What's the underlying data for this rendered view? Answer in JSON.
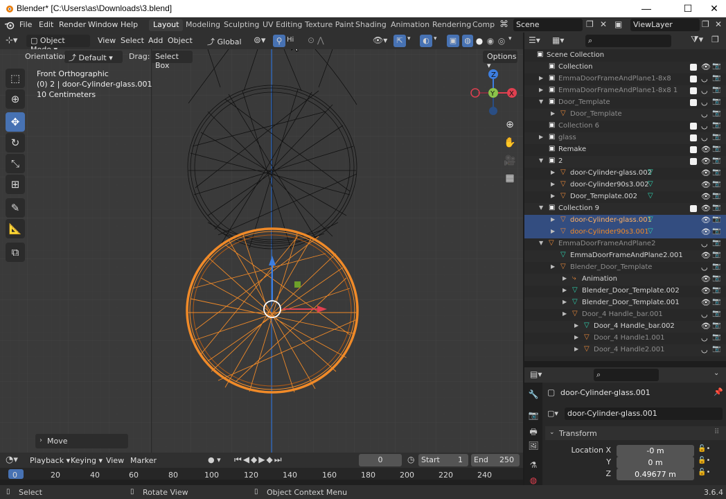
{
  "window": {
    "title": "Blender* [C:\\Users\\as\\Downloads\\3.blend]",
    "minimize": "—",
    "maximize": "☐",
    "close": "✕"
  },
  "menu": {
    "items": [
      "File",
      "Edit",
      "Render",
      "Window",
      "Help"
    ]
  },
  "workspaces": [
    "Layout",
    "Modeling",
    "Sculpting",
    "UV Editing",
    "Texture Paint",
    "Shading",
    "Animation",
    "Rendering",
    "Comp"
  ],
  "scene": {
    "label": "Scene",
    "view_layer": "ViewLayer"
  },
  "viewport_header": {
    "mode": "Object Mode",
    "view": "View",
    "select": "Select",
    "add": "Add",
    "object": "Object",
    "orientation": "Global",
    "snap_label": "Hi"
  },
  "viewport_sub": {
    "orientation_label": "Orientation:",
    "orientation_value": "Default",
    "drag_label": "Drag:",
    "drag_value": "Select Box",
    "options": "Options"
  },
  "overlay_text": {
    "view_name": "Front Orthographic",
    "object_info": "(0) 2 | door-Cylinder-glass.001",
    "scale": "10 Centimeters"
  },
  "gizmo": {
    "z": "Z",
    "y": "Y",
    "x": "X"
  },
  "operator_panel": "Move",
  "timeline": {
    "playback": "Playback",
    "keying": "Keying",
    "view": "View",
    "marker": "Marker",
    "current_frame": "0",
    "start_label": "Start",
    "start": "1",
    "end_label": "End",
    "end": "250",
    "ticks": [
      "0",
      "20",
      "40",
      "60",
      "80",
      "100",
      "120",
      "140",
      "160",
      "180",
      "200",
      "220",
      "240"
    ]
  },
  "statusbar": {
    "select": "Select",
    "rotate": "Rotate View",
    "context": "Object Context Menu",
    "version": "3.6.4"
  },
  "outliner": {
    "rows": [
      {
        "label": "Scene Collection",
        "indent": 0,
        "icon": "collection",
        "state": "normal"
      },
      {
        "label": "Collection",
        "indent": 1,
        "icon": "collection",
        "state": "normal",
        "check": true
      },
      {
        "label": "EmmaDoorFrameAndPlane1-8x8",
        "indent": 1,
        "icon": "collection",
        "state": "dim",
        "check": true,
        "arrow": true
      },
      {
        "label": "EmmaDoorFrameAndPlane1-8x8 1",
        "indent": 1,
        "icon": "collection",
        "state": "dim",
        "check": true,
        "arrow": true
      },
      {
        "label": "Door_Template",
        "indent": 1,
        "icon": "collection",
        "state": "dim",
        "check": true,
        "arrow": true
      },
      {
        "label": "Door_Template",
        "indent": 2,
        "icon": "object",
        "state": "dim",
        "arrow": true
      },
      {
        "label": "Collection 6",
        "indent": 1,
        "icon": "collection",
        "state": "dim",
        "check": true
      },
      {
        "label": "glass",
        "indent": 1,
        "icon": "collection",
        "state": "dim",
        "check": true,
        "arrow": true
      },
      {
        "label": "Remake",
        "indent": 1,
        "icon": "collection",
        "state": "normal",
        "check": true
      },
      {
        "label": "2",
        "indent": 1,
        "icon": "collection",
        "state": "normal",
        "check": true,
        "arrow": true
      },
      {
        "label": "door-Cylinder-glass.002",
        "indent": 2,
        "icon": "object",
        "state": "normal",
        "arrow": true
      },
      {
        "label": "door-Cylinder90s3.002",
        "indent": 2,
        "icon": "object",
        "state": "normal",
        "arrow": true
      },
      {
        "label": "Door_Template.002",
        "indent": 2,
        "icon": "object",
        "state": "normal",
        "arrow": true
      },
      {
        "label": "Collection 9",
        "indent": 1,
        "icon": "collection",
        "state": "normal",
        "check": true,
        "arrow": true
      },
      {
        "label": "door-Cylinder-glass.001",
        "indent": 2,
        "icon": "object",
        "state": "active",
        "arrow": true
      },
      {
        "label": "door-Cylinder90s3.001",
        "indent": 2,
        "icon": "object",
        "state": "selected",
        "arrow": true
      },
      {
        "label": "EmmaDoorFrameAndPlane2",
        "indent": 1,
        "icon": "object",
        "state": "dim",
        "arrow": true
      },
      {
        "label": "EmmaDoorFrameAndPlane2.001",
        "indent": 2,
        "icon": "mesh",
        "state": "normal"
      },
      {
        "label": "Blender_Door_Template",
        "indent": 2,
        "icon": "object",
        "state": "dim",
        "arrow": true
      },
      {
        "label": "Animation",
        "indent": 3,
        "icon": "anim",
        "state": "normal",
        "arrow": true
      },
      {
        "label": "Blender_Door_Template.002",
        "indent": 3,
        "icon": "mesh",
        "state": "normal",
        "arrow": true
      },
      {
        "label": "Blender_Door_Template.001",
        "indent": 3,
        "icon": "mesh",
        "state": "normal",
        "arrow": true
      },
      {
        "label": "Door_4 Handle_bar.001",
        "indent": 3,
        "icon": "object",
        "state": "dim",
        "arrow": true
      },
      {
        "label": "Door_4 Handle_bar.002",
        "indent": 4,
        "icon": "mesh",
        "state": "normal",
        "arrow": true
      },
      {
        "label": "Door_4 Handle1.001",
        "indent": 4,
        "icon": "object",
        "state": "dim",
        "arrow": true
      },
      {
        "label": "Door_4 Handle2.001",
        "indent": 4,
        "icon": "object",
        "state": "dim",
        "arrow": true
      }
    ]
  },
  "properties": {
    "object_name": "door-Cylinder-glass.001",
    "object_field": "door-Cylinder-glass.001",
    "panel": "Transform",
    "location_label": "Location X",
    "y_label": "Y",
    "z_label": "Z",
    "loc_x": "-0 m",
    "loc_y": "0 m",
    "loc_z": "0.49677 m"
  },
  "colors": {
    "selected_orange": "#f08a28",
    "active_highlight": "#334d80",
    "axis_x": "#e04050",
    "axis_y": "#8bc34a",
    "axis_z": "#3d7ee0",
    "viewport_bg": "#3a3a3a"
  },
  "icons": [
    "blender-logo",
    "cursor-icon",
    "move-icon",
    "rotate-icon",
    "scale-icon",
    "transform-icon",
    "annotate-icon",
    "measure-icon",
    "add-cube-icon",
    "zoom-icon",
    "hand-icon",
    "camera-icon",
    "grid-icon",
    "eye-icon",
    "camera-render-icon",
    "search-icon",
    "filter-icon"
  ]
}
